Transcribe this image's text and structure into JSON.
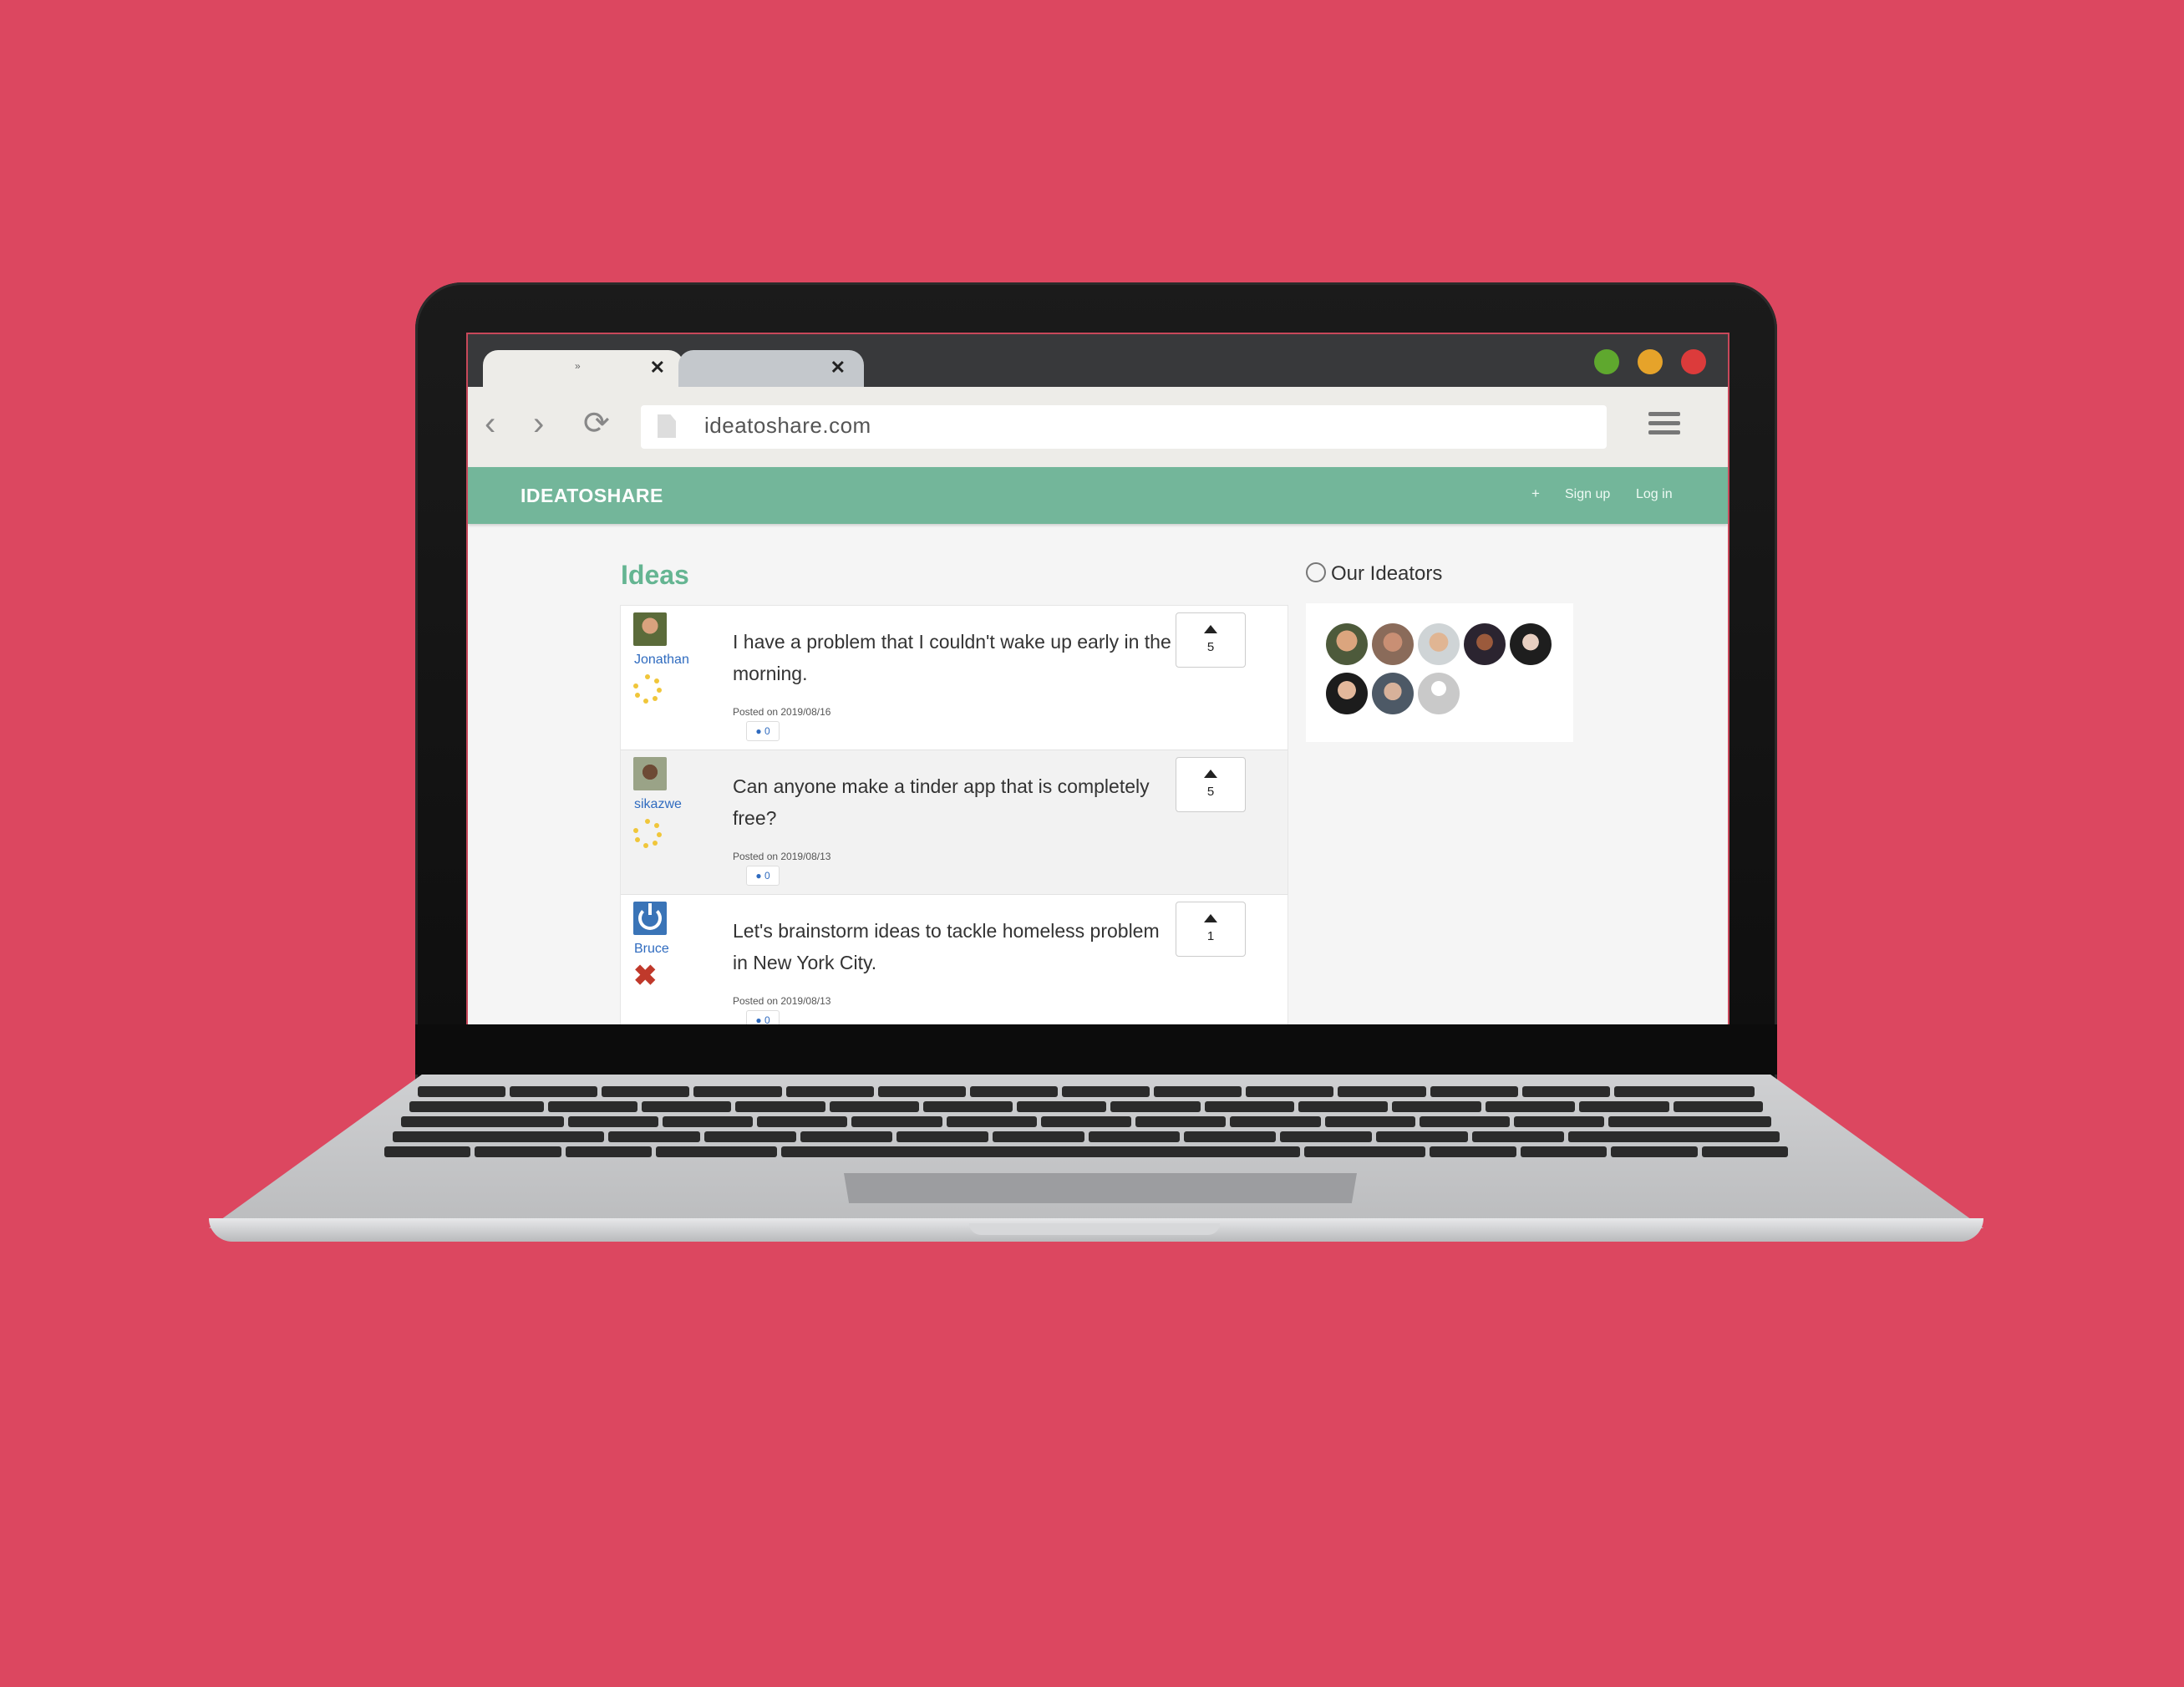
{
  "browser": {
    "tabs": [
      {
        "title": "»",
        "close": "✕"
      },
      {
        "title": "",
        "close": "✕"
      }
    ],
    "url": "ideatoshare.com",
    "window_controls": [
      "green-dot",
      "yellow-dot",
      "red-dot"
    ],
    "icons": [
      "back-icon",
      "forward-icon",
      "reload-icon",
      "document-icon",
      "menu-icon"
    ]
  },
  "site": {
    "brand": "IDEATOSHARE",
    "nav": {
      "plus": "+",
      "signup": "Sign up",
      "login": "Log in"
    },
    "accent": "#73b69a"
  },
  "ideas": {
    "heading": "Ideas",
    "items": [
      {
        "user": "Jonathan",
        "text": "I have a problem that I couldn't wake up early in the morning.",
        "posted": "Posted on 2019/08/16",
        "comments": "0",
        "votes": "5",
        "badge": "dots"
      },
      {
        "user": "sikazwe",
        "text": "Can anyone make a tinder app that is completely free?",
        "posted": "Posted on 2019/08/13",
        "comments": "0",
        "votes": "5",
        "badge": "dots"
      },
      {
        "user": "Bruce",
        "text": "Let's brainstorm ideas to tackle homeless problem in New York City.",
        "posted": "Posted on 2019/08/13",
        "comments": "0",
        "votes": "1",
        "badge": "x"
      }
    ]
  },
  "sidebar": {
    "heading": "Our Ideators",
    "ideator_count": 8
  }
}
